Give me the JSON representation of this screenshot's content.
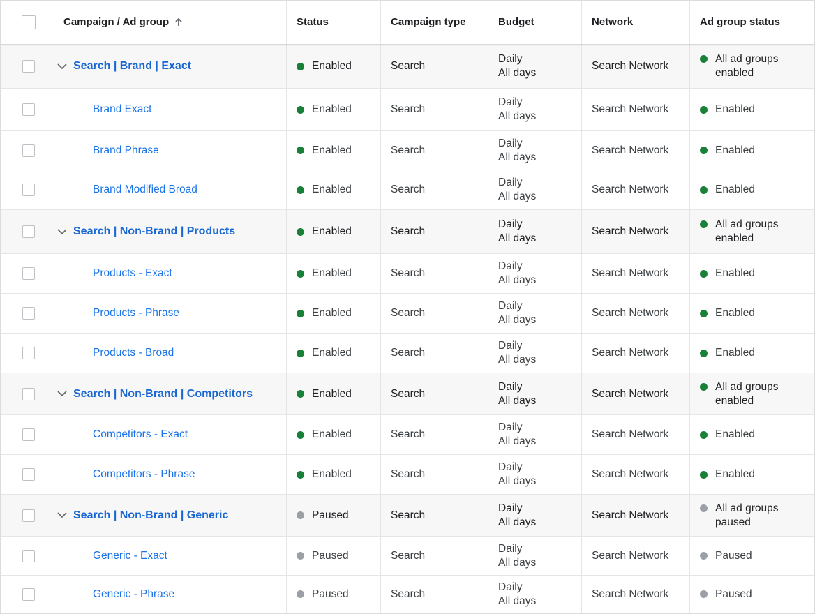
{
  "colors": {
    "link": "#1a73e8",
    "enabled": "#188038",
    "paused": "#9aa0a6"
  },
  "header": {
    "columns": {
      "name": "Campaign / Ad group",
      "status": "Status",
      "type": "Campaign type",
      "budget": "Budget",
      "network": "Network",
      "ag_status": "Ad group status"
    },
    "sort_icon": "arrow-up-icon"
  },
  "rows": [
    {
      "kind": "campaign",
      "name": "Search | Brand | Exact",
      "status": "Enabled",
      "status_color": "enabled",
      "type": "Search",
      "budget_1": "Daily",
      "budget_2": "All days",
      "network": "Search Network",
      "ag_status_1": "All ad groups",
      "ag_status_2": "enabled",
      "ag_color": "enabled"
    },
    {
      "kind": "adgroup",
      "name": "Brand Exact",
      "status": "Enabled",
      "status_color": "enabled",
      "type": "Search",
      "budget_1": "Daily",
      "budget_2": "All days",
      "network": "Search Network",
      "ag_status_1": "Enabled",
      "ag_status_2": "",
      "ag_color": "enabled"
    },
    {
      "kind": "adgroup",
      "name": "Brand Phrase",
      "status": "Enabled",
      "status_color": "enabled",
      "type": "Search",
      "budget_1": "Daily",
      "budget_2": "All days",
      "network": "Search Network",
      "ag_status_1": "Enabled",
      "ag_status_2": "",
      "ag_color": "enabled"
    },
    {
      "kind": "adgroup",
      "name": "Brand Modified Broad",
      "status": "Enabled",
      "status_color": "enabled",
      "type": "Search",
      "budget_1": "Daily",
      "budget_2": "All days",
      "network": "Search Network",
      "ag_status_1": "Enabled",
      "ag_status_2": "",
      "ag_color": "enabled"
    },
    {
      "kind": "campaign",
      "name": "Search | Non-Brand | Products",
      "status": "Enabled",
      "status_color": "enabled",
      "type": "Search",
      "budget_1": "Daily",
      "budget_2": "All days",
      "network": "Search Network",
      "ag_status_1": "All ad groups",
      "ag_status_2": "enabled",
      "ag_color": "enabled"
    },
    {
      "kind": "adgroup",
      "name": "Products - Exact",
      "status": "Enabled",
      "status_color": "enabled",
      "type": "Search",
      "budget_1": "Daily",
      "budget_2": "All days",
      "network": "Search Network",
      "ag_status_1": "Enabled",
      "ag_status_2": "",
      "ag_color": "enabled"
    },
    {
      "kind": "adgroup",
      "name": "Products - Phrase",
      "status": "Enabled",
      "status_color": "enabled",
      "type": "Search",
      "budget_1": "Daily",
      "budget_2": "All days",
      "network": "Search Network",
      "ag_status_1": "Enabled",
      "ag_status_2": "",
      "ag_color": "enabled"
    },
    {
      "kind": "adgroup",
      "name": "Products - Broad",
      "status": "Enabled",
      "status_color": "enabled",
      "type": "Search",
      "budget_1": "Daily",
      "budget_2": "All days",
      "network": "Search Network",
      "ag_status_1": "Enabled",
      "ag_status_2": "",
      "ag_color": "enabled"
    },
    {
      "kind": "campaign",
      "name": "Search | Non-Brand | Competitors",
      "status": "Enabled",
      "status_color": "enabled",
      "type": "Search",
      "budget_1": "Daily",
      "budget_2": "All days",
      "network": "Search Network",
      "ag_status_1": "All ad groups",
      "ag_status_2": "enabled",
      "ag_color": "enabled"
    },
    {
      "kind": "adgroup",
      "name": "Competitors - Exact",
      "status": "Enabled",
      "status_color": "enabled",
      "type": "Search",
      "budget_1": "Daily",
      "budget_2": "All days",
      "network": "Search Network",
      "ag_status_1": "Enabled",
      "ag_status_2": "",
      "ag_color": "enabled"
    },
    {
      "kind": "adgroup",
      "name": "Competitors - Phrase",
      "status": "Enabled",
      "status_color": "enabled",
      "type": "Search",
      "budget_1": "Daily",
      "budget_2": "All days",
      "network": "Search Network",
      "ag_status_1": "Enabled",
      "ag_status_2": "",
      "ag_color": "enabled"
    },
    {
      "kind": "campaign",
      "name": "Search | Non-Brand | Generic",
      "status": "Paused",
      "status_color": "paused",
      "type": "Search",
      "budget_1": "Daily",
      "budget_2": "All days",
      "network": "Search Network",
      "ag_status_1": "All ad groups",
      "ag_status_2": "paused",
      "ag_color": "paused"
    },
    {
      "kind": "adgroup",
      "name": "Generic - Exact",
      "status": "Paused",
      "status_color": "paused",
      "type": "Search",
      "budget_1": "Daily",
      "budget_2": "All days",
      "network": "Search Network",
      "ag_status_1": "Paused",
      "ag_status_2": "",
      "ag_color": "paused"
    },
    {
      "kind": "adgroup",
      "name": "Generic - Phrase",
      "status": "Paused",
      "status_color": "paused",
      "type": "Search",
      "budget_1": "Daily",
      "budget_2": "All days",
      "network": "Search Network",
      "ag_status_1": "Paused",
      "ag_status_2": "",
      "ag_color": "paused"
    }
  ]
}
